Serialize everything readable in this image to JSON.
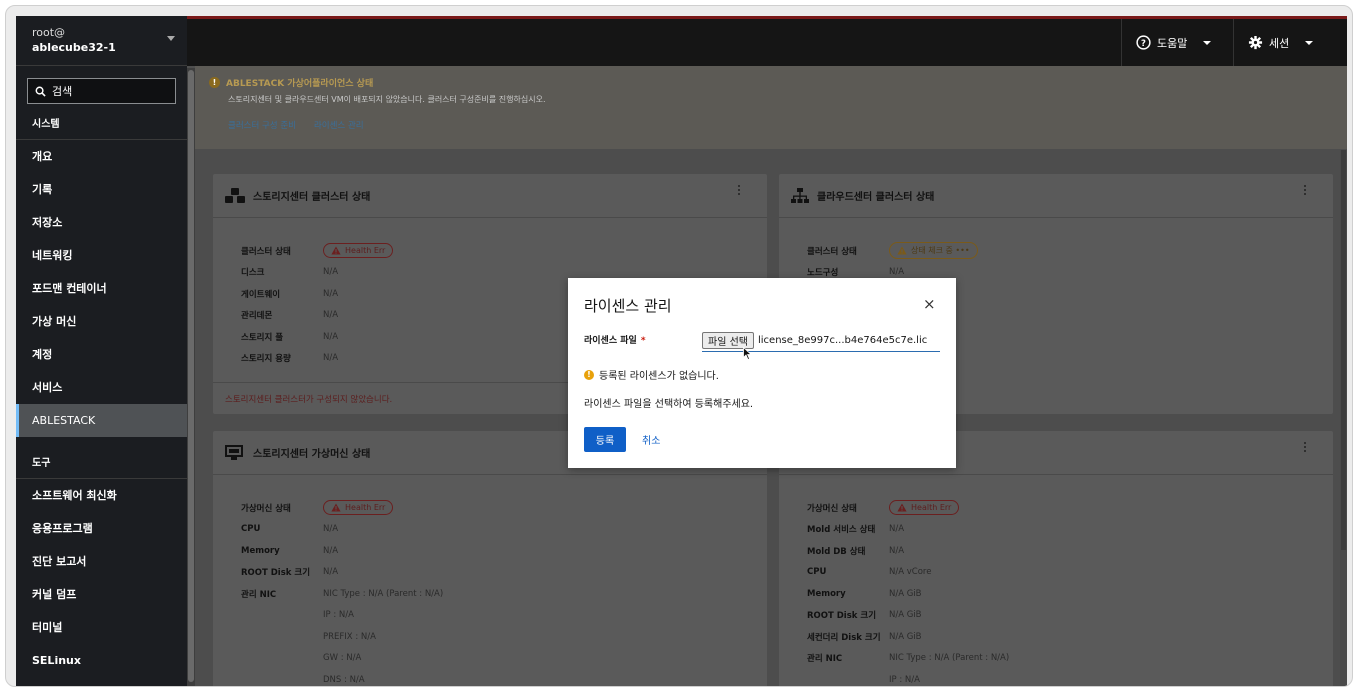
{
  "host": {
    "user": "root@",
    "name": "ablecube32-1"
  },
  "search": {
    "label": "검색"
  },
  "sidebar": {
    "group_system": "시스템",
    "items_system": [
      "개요",
      "기록",
      "저장소",
      "네트워킹",
      "포드맨 컨테이너",
      "가상 머신",
      "계정",
      "서비스",
      "ABLESTACK"
    ],
    "active": "ABLESTACK",
    "group_tools": "도구",
    "items_tools": [
      "소프트웨어 최신화",
      "응용프로그램",
      "진단 보고서",
      "커널 덤프",
      "터미널",
      "SELinux"
    ]
  },
  "topbar": {
    "help_label": "도움말",
    "session_label": "세션"
  },
  "alert": {
    "title": "ABLESTACK 가상어플라이언스 상태",
    "description": "스토리지센터 및 클라우드센터 VM이 배포되지 않았습니다. 클러스터 구성준비를 진행하십시오.",
    "link_prepare": "클러스터 구성 준비",
    "link_license": "라이센스 관리"
  },
  "storage_cluster": {
    "title": "스토리지센터 클러스터 상태",
    "rows": [
      {
        "k": "클러스터 상태",
        "v": "Health Err",
        "badge": "error"
      },
      {
        "k": "디스크",
        "v": "N/A"
      },
      {
        "k": "게이트웨이",
        "v": "N/A"
      },
      {
        "k": "관리데몬",
        "v": "N/A"
      },
      {
        "k": "스토리지 풀",
        "v": "N/A"
      },
      {
        "k": "스토리지 용량",
        "v": "N/A"
      }
    ],
    "footer": "스토리지센터 클러스터가 구성되지 않았습니다."
  },
  "cloud_cluster": {
    "title": "클라우드센터 클러스터 상태",
    "rows": [
      {
        "k": "클러스터 상태",
        "v": "상태 체크 중 •••",
        "badge": "warning"
      },
      {
        "k": "노드구성",
        "v": "N/A"
      }
    ]
  },
  "storage_vm": {
    "title": "스토리지센터 가상머신 상태",
    "rows": [
      {
        "k": "가상머신 상태",
        "v": "Health Err",
        "badge": "error"
      },
      {
        "k": "CPU",
        "v": "N/A"
      },
      {
        "k": "Memory",
        "v": "N/A"
      },
      {
        "k": "ROOT Disk 크기",
        "v": "N/A"
      },
      {
        "k": "관리 NIC",
        "v": "NIC Type : N/A (Parent : N/A)"
      },
      {
        "k": "",
        "v": "IP : N/A"
      },
      {
        "k": "",
        "v": "PREFIX : N/A"
      },
      {
        "k": "",
        "v": "GW : N/A"
      },
      {
        "k": "",
        "v": "DNS : N/A"
      }
    ]
  },
  "cloud_vm": {
    "rows": [
      {
        "k": "가상머신 상태",
        "v": "Health Err",
        "badge": "error"
      },
      {
        "k": "Mold 서비스 상태",
        "v": "N/A"
      },
      {
        "k": "Mold DB 상태",
        "v": "N/A"
      },
      {
        "k": "CPU",
        "v": "N/A vCore"
      },
      {
        "k": "Memory",
        "v": "N/A GiB"
      },
      {
        "k": "ROOT Disk 크기",
        "v": "N/A GiB"
      },
      {
        "k": "세컨더리 Disk 크기",
        "v": "N/A GiB"
      },
      {
        "k": "관리 NIC",
        "v": "NIC Type : N/A (Parent : N/A)"
      },
      {
        "k": "",
        "v": "IP : N/A"
      }
    ]
  },
  "modal": {
    "title": "라이센스 관리",
    "close": "×",
    "file_label": "라이센스 파일",
    "required_mark": "*",
    "file_button": "파일 선택",
    "file_name": "license_8e997c...b4e764e5c7e.lic",
    "info_icon": "!",
    "info_text": "등록된 라이센스가 없습니다.",
    "hint": "라이센스 파일을 선택하여 등록해주세요.",
    "submit": "등록",
    "cancel": "취소"
  },
  "colors": {
    "primary": "#0f5fc7",
    "error": "#c9190b",
    "warning": "#e8a10a"
  }
}
